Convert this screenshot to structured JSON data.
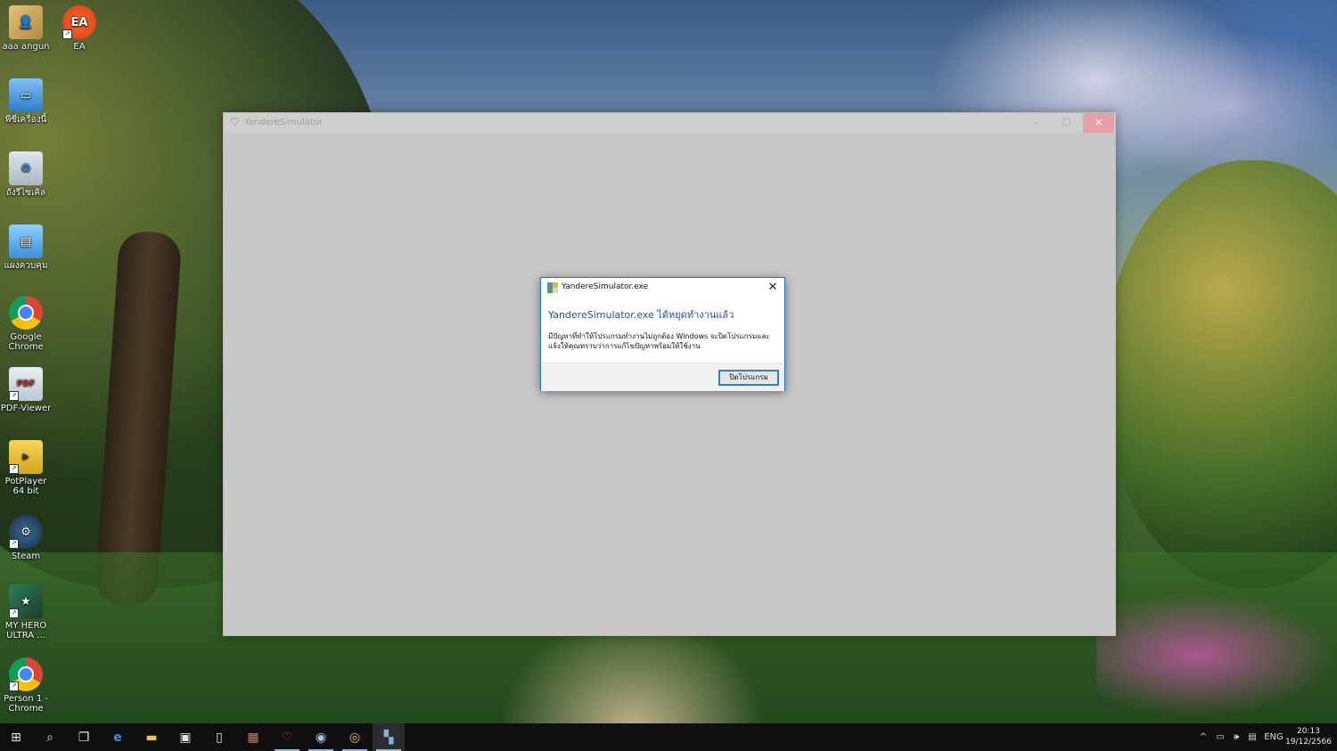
{
  "desktop": {
    "icons": [
      {
        "label": "aaa angun",
        "icon": "user-folder-icon"
      },
      {
        "label": "EA",
        "icon": "ea-app-icon"
      },
      {
        "label": "พีซีเครื่องนี้",
        "icon": "this-pc-icon"
      },
      {
        "label": "ถังรีไซเคิล",
        "icon": "recycle-bin-icon"
      },
      {
        "label": "แผงควบคุม",
        "icon": "control-panel-icon"
      },
      {
        "label": "Google Chrome",
        "icon": "chrome-icon"
      },
      {
        "label": "PDF-Viewer",
        "icon": "pdf-viewer-icon"
      },
      {
        "label": "PotPlayer 64 bit",
        "icon": "potplayer-icon"
      },
      {
        "label": "Steam",
        "icon": "steam-icon"
      },
      {
        "label": "MY HERO ULTRA ...",
        "icon": "game-icon"
      },
      {
        "label": "Person 1 - Chrome",
        "icon": "chrome-profile-icon"
      }
    ]
  },
  "app_window": {
    "title": "YandereSimulator",
    "minimize": "–",
    "maximize": "☐",
    "close": "✕"
  },
  "dialog": {
    "title": "YandereSimulator.exe",
    "close": "✕",
    "heading": "YandereSimulator.exe ได้หยุดทำงานแล้ว",
    "message": "มีปัญหาที่ทำให้โปรแกรมทำงานไม่ถูกต้อง Windows จะปิดโปรแกรมและแจ้งให้คุณทราบว่าการแก้ไขปัญหาพร้อมให้ใช้งาน",
    "button": "ปิดโปรแกรม"
  },
  "taskbar": {
    "items": [
      {
        "name": "start-button",
        "icon": "windows-logo-icon",
        "glyph": "⊞"
      },
      {
        "name": "search-button",
        "icon": "search-icon",
        "glyph": "⌕"
      },
      {
        "name": "task-view-button",
        "icon": "task-view-icon",
        "glyph": "❐"
      },
      {
        "name": "taskbar-edge",
        "icon": "edge-icon",
        "glyph": "e"
      },
      {
        "name": "taskbar-file-explorer",
        "icon": "folder-icon",
        "glyph": "▬"
      },
      {
        "name": "taskbar-store",
        "icon": "store-icon",
        "glyph": "▣"
      },
      {
        "name": "taskbar-notepad",
        "icon": "document-icon",
        "glyph": "▯"
      },
      {
        "name": "taskbar-app",
        "icon": "app-grid-icon",
        "glyph": "▦"
      },
      {
        "name": "taskbar-yandere",
        "icon": "yandere-icon",
        "glyph": "♡"
      },
      {
        "name": "taskbar-steam",
        "icon": "steam-icon",
        "glyph": "◉"
      },
      {
        "name": "taskbar-chrome",
        "icon": "chrome-icon",
        "glyph": "◎"
      },
      {
        "name": "taskbar-error-reporting",
        "icon": "error-reporting-icon",
        "glyph": "▚"
      }
    ],
    "tray": {
      "chevron": "^",
      "language": "ENG",
      "time": "20:13",
      "date": "19/12/2566"
    }
  }
}
